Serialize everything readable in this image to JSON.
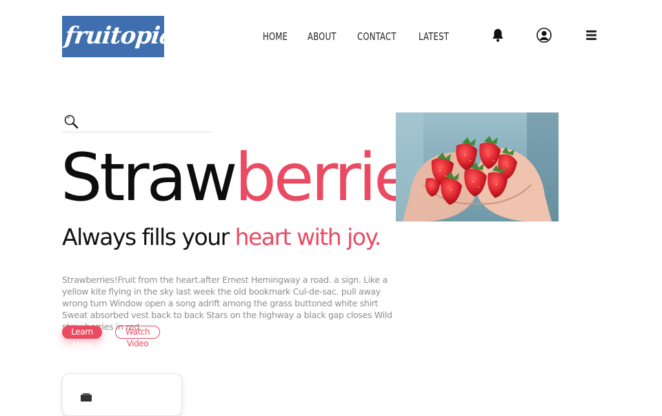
{
  "brand": {
    "logo_text": "fruitopia",
    "logo_bg": "#3f6fae"
  },
  "nav": {
    "items": [
      {
        "label": "HOME"
      },
      {
        "label": "ABOUT"
      },
      {
        "label": "CONTACT"
      },
      {
        "label": "LATEST"
      }
    ],
    "icons": [
      "bell-icon",
      "user-circle-icon",
      "menu-icon"
    ]
  },
  "search": {
    "placeholder": "",
    "icon": "search-icon"
  },
  "hero": {
    "title_part1": "Straw",
    "title_part2": "berries",
    "subtitle_part1": "Always fills your ",
    "subtitle_part2": "heart with joy.",
    "description": "Strawberries!Fruit from the heart.after Ernest Hemingway a road. a sign. Like a yellow kite flying in the sky last week the old bookmark Cul-de-sac. pull away wrong turn Window open a song adrift among the grass buttoned white shirt Sweat absorbed vest back to back Stars on the highway a black gap closes Wild strawberries in red.",
    "primary_button": "Learn More",
    "secondary_button": "Watch Video",
    "image_alt": "hands-holding-strawberries"
  },
  "colors": {
    "accent": "#ea4a62",
    "text": "#111111",
    "muted": "#8e8e8e"
  }
}
